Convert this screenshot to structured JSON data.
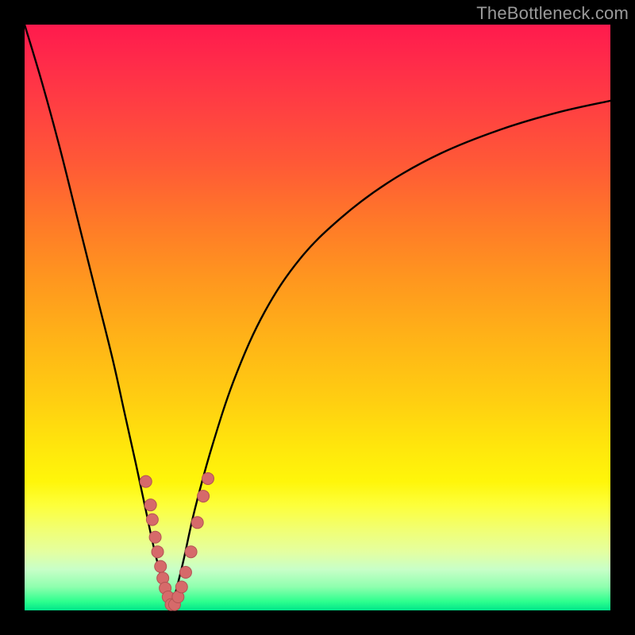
{
  "watermark": "TheBottleneck.com",
  "colors": {
    "curve": "#000000",
    "marker_fill": "#d66a6a",
    "marker_stroke": "#b35353",
    "frame": "#000000"
  },
  "chart_data": {
    "type": "line",
    "title": "",
    "xlabel": "",
    "ylabel": "",
    "xlim": [
      0,
      100
    ],
    "ylim": [
      0,
      100
    ],
    "note": "Axes have no tick labels; values are estimated as percent of plot area. y=0 at bottom, y=100 at top.",
    "series": [
      {
        "name": "left-branch",
        "x": [
          0,
          3,
          6,
          9,
          12,
          15,
          17,
          19,
          20.5,
          22,
          23.5,
          25
        ],
        "y": [
          100,
          90,
          79,
          67,
          55,
          43,
          34,
          25,
          18,
          11,
          5,
          0
        ]
      },
      {
        "name": "right-branch",
        "x": [
          25,
          27,
          29,
          32,
          36,
          41,
          47,
          54,
          62,
          71,
          81,
          91,
          100
        ],
        "y": [
          0,
          8,
          17,
          28,
          40,
          51,
          60,
          67,
          73,
          78,
          82,
          85,
          87
        ]
      }
    ],
    "markers": {
      "name": "dots",
      "points": [
        {
          "x": 20.7,
          "y": 22.0
        },
        {
          "x": 21.5,
          "y": 18.0
        },
        {
          "x": 21.8,
          "y": 15.5
        },
        {
          "x": 22.3,
          "y": 12.5
        },
        {
          "x": 22.7,
          "y": 10.0
        },
        {
          "x": 23.2,
          "y": 7.5
        },
        {
          "x": 23.6,
          "y": 5.5
        },
        {
          "x": 24.0,
          "y": 3.8
        },
        {
          "x": 24.5,
          "y": 2.3
        },
        {
          "x": 25.0,
          "y": 1.0
        },
        {
          "x": 25.6,
          "y": 1.0
        },
        {
          "x": 26.2,
          "y": 2.3
        },
        {
          "x": 26.8,
          "y": 4.0
        },
        {
          "x": 27.5,
          "y": 6.5
        },
        {
          "x": 28.4,
          "y": 10.0
        },
        {
          "x": 29.5,
          "y": 15.0
        },
        {
          "x": 30.5,
          "y": 19.5
        },
        {
          "x": 31.3,
          "y": 22.5
        }
      ]
    }
  }
}
